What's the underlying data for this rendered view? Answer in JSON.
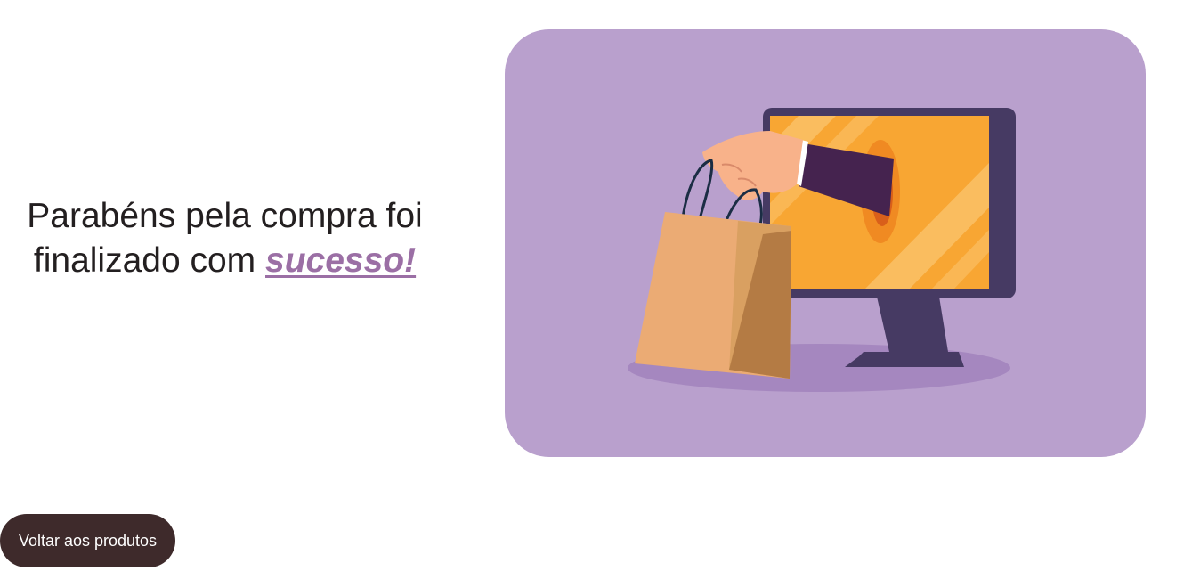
{
  "message": {
    "line1": "Parabéns pela compra foi",
    "line2_prefix": "finalizado com ",
    "highlight": "sucesso!"
  },
  "hero": {
    "icon": "online-shopping-illustration",
    "background_color": "#b9a0cd"
  },
  "actions": {
    "back_label": "Voltar aos produtos"
  },
  "colors": {
    "accent": "#9b6fa5",
    "button_bg": "#3e2a2b",
    "text": "#231f20"
  }
}
